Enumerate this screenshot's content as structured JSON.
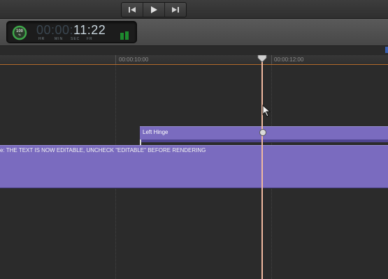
{
  "transport": {
    "buttons": [
      "skip-to-start",
      "play",
      "skip-to-end"
    ]
  },
  "timecode": {
    "percent": "100",
    "percent_unit": "%",
    "dim_part": "00:00:",
    "bright_part": "11:22",
    "units": [
      "HR",
      "MIN",
      "SEC",
      "FR"
    ]
  },
  "ruler": {
    "labels": [
      "00:00:10:00",
      "00:00:12:00"
    ]
  },
  "clips": {
    "title_clip_label": "Left Hinge",
    "main_clip_label": "e: THE TEXT IS NOW EDITABLE, UNCHECK \"EDITABLE\" BEFORE RENDERING"
  },
  "colors": {
    "clip": "#7a6bbf",
    "playhead": "#f0b9a0",
    "ruler_accent": "#b36a2b"
  }
}
